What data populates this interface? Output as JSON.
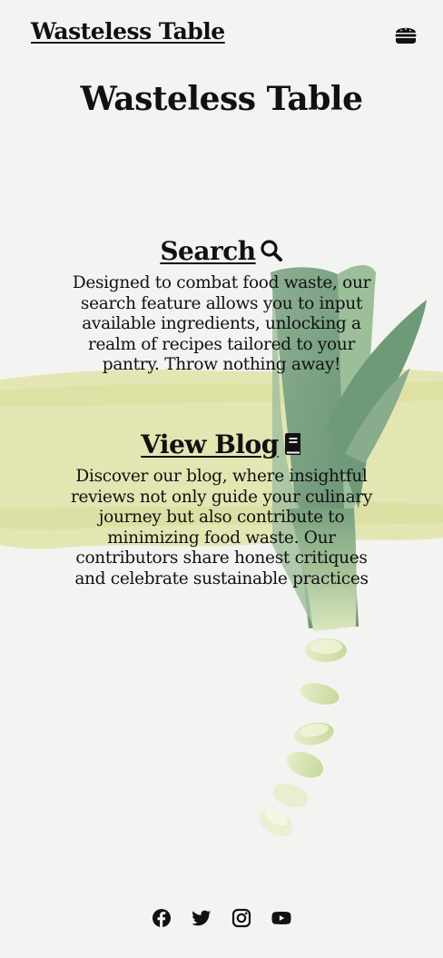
{
  "navbar": {
    "brand": "Wasteless Table",
    "menu_icon": "burger-icon"
  },
  "hero": {
    "title": "Wasteless Table"
  },
  "sections": [
    {
      "link_label": "Search",
      "icon": "search-icon",
      "description": "Designed to combat food waste, our search feature allows you to input available ingredients, unlocking a realm of recipes tailored to your pantry. Throw nothing away!"
    },
    {
      "link_label": "View Blog",
      "icon": "book-icon",
      "description": "Discover our blog, where insightful reviews not only guide your culinary journey but also contribute to minimizing food waste. Our contributors share honest critiques and celebrate sustainable practices"
    }
  ],
  "footer": {
    "social": [
      "facebook-icon",
      "twitter-icon",
      "instagram-icon",
      "youtube-icon"
    ]
  },
  "colors": {
    "background": "#f3f4f1",
    "brush_stroke": "#dfe2a8",
    "leek_green": "#6f9a78",
    "leek_white": "#dfe8c8",
    "text": "#111111"
  }
}
